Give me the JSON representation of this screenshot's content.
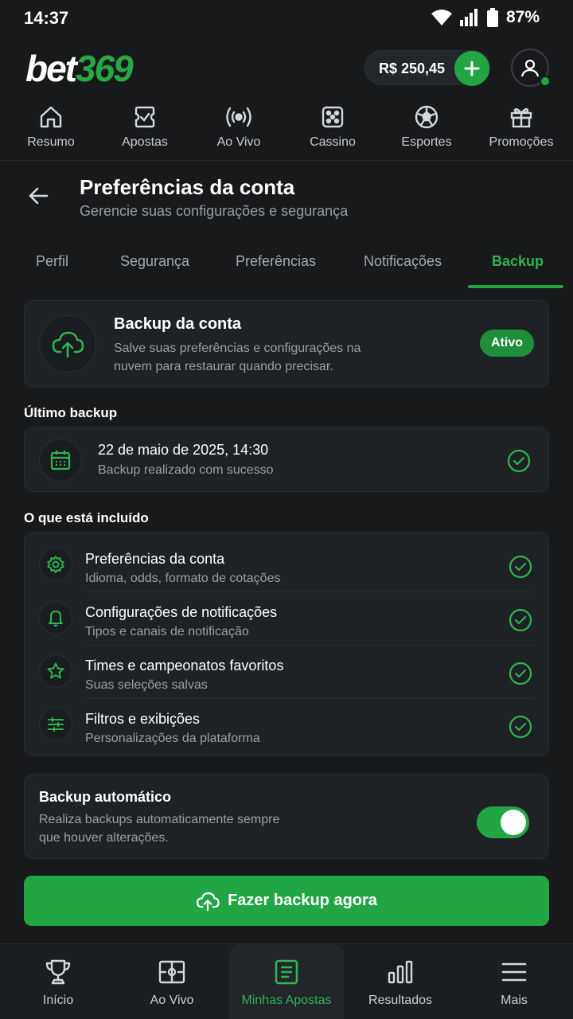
{
  "status_bar": {
    "time": "14:37",
    "battery": "87%"
  },
  "header": {
    "logo_white": "bet",
    "logo_green": "369",
    "balance": "R$ 250,45"
  },
  "top_nav": [
    {
      "label": "Resumo",
      "icon": "home-icon"
    },
    {
      "label": "Apostas",
      "icon": "ticket-check-icon"
    },
    {
      "label": "Ao Vivo",
      "icon": "live-broadcast-icon"
    },
    {
      "label": "Cassino",
      "icon": "dice-icon"
    },
    {
      "label": "Esportes",
      "icon": "soccer-ball-icon"
    },
    {
      "label": "Promoções",
      "icon": "gift-icon"
    }
  ],
  "page": {
    "title": "Preferências da conta",
    "subtitle": "Gerencie suas configurações e segurança"
  },
  "tabs": [
    "Perfil",
    "Segurança",
    "Preferências",
    "Notificações",
    "Backup"
  ],
  "active_tab": "Backup",
  "backup_card": {
    "title": "Backup da conta",
    "description": "Salve suas preferências e configurações na nuvem para restaurar quando precisar.",
    "badge": "Ativo"
  },
  "last_backup": {
    "label": "Último backup",
    "date": "22 de maio de 2025, 14:30",
    "status": "Backup realizado com sucesso"
  },
  "included": {
    "label": "O que está incluído",
    "items": [
      {
        "title": "Preferências da conta",
        "subtitle": "Idioma, odds, formato de cotações",
        "icon": "gear-icon"
      },
      {
        "title": "Configurações de notificações",
        "subtitle": "Tipos e canais de notificação",
        "icon": "bell-icon"
      },
      {
        "title": "Times e campeonatos favoritos",
        "subtitle": "Suas seleções salvas",
        "icon": "star-icon"
      },
      {
        "title": "Filtros e exibições",
        "subtitle": "Personalizações da plataforma",
        "icon": "sliders-icon"
      }
    ]
  },
  "auto_backup": {
    "title": "Backup automático",
    "description": "Realiza backups automaticamente sempre que houver alterações.",
    "enabled": true
  },
  "cta": {
    "label": "Fazer backup agora"
  },
  "bottom_nav": [
    {
      "label": "Início",
      "icon": "trophy-icon"
    },
    {
      "label": "Ao Vivo",
      "icon": "scoreboard-icon"
    },
    {
      "label": "Minhas Apostas",
      "icon": "bet-slip-icon",
      "active": true
    },
    {
      "label": "Resultados",
      "icon": "bar-chart-icon"
    },
    {
      "label": "Mais",
      "icon": "menu-icon"
    }
  ],
  "colors": {
    "accent": "#22a543",
    "background": "#17191b",
    "card": "#1f2225"
  }
}
